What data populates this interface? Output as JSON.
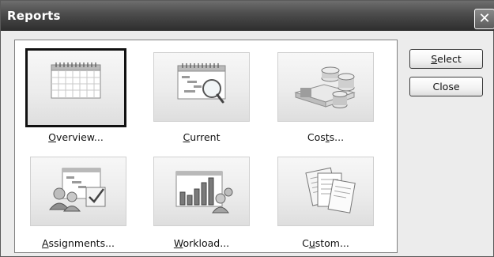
{
  "window": {
    "title": "Reports",
    "close_glyph": "✕"
  },
  "reports": [
    {
      "label_pre": "",
      "label_key": "O",
      "label_post": "verview...",
      "icon": "calendar-grid-icon",
      "selected": true
    },
    {
      "label_pre": "",
      "label_key": "C",
      "label_post": "urrent",
      "icon": "calendar-magnifier-icon",
      "selected": false
    },
    {
      "label_pre": "Cos",
      "label_key": "t",
      "label_post": "s...",
      "icon": "coins-money-icon",
      "selected": false
    },
    {
      "label_pre": "",
      "label_key": "A",
      "label_post": "ssignments...",
      "icon": "people-tasks-icon",
      "selected": false
    },
    {
      "label_pre": "",
      "label_key": "W",
      "label_post": "orkload...",
      "icon": "bar-chart-people-icon",
      "selected": false
    },
    {
      "label_pre": "C",
      "label_key": "u",
      "label_post": "stom...",
      "icon": "documents-icon",
      "selected": false
    }
  ],
  "buttons": {
    "select": {
      "pre": "",
      "key": "S",
      "post": "elect"
    },
    "close": {
      "label": "Close"
    }
  }
}
